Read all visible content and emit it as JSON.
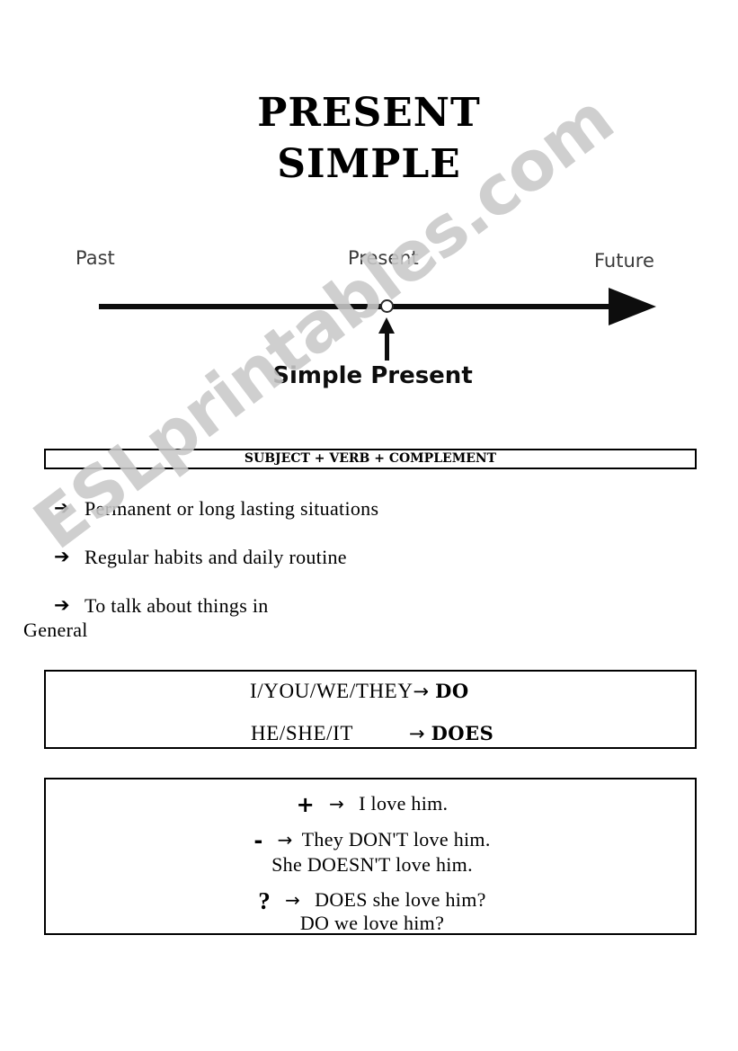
{
  "document": {
    "title_lines": [
      "PRESENT",
      "SIMPLE"
    ],
    "watermark": "ESLprintables.com"
  },
  "timeline": {
    "labels": {
      "past": "Past",
      "present": "Present",
      "future": "Future"
    },
    "caption": "Simple Present",
    "marker_icon": "timeline-now-dot",
    "pointer_icon": "up-arrow-icon",
    "axis_arrow_icon": "right-arrowhead-icon"
  },
  "formula": {
    "text": "SUBJECT + VERB + COMPLEMENT"
  },
  "usage": {
    "bullet_glyph": "➔",
    "items": [
      {
        "text": "Permanent or long lasting situations"
      },
      {
        "text": "Regular habits and daily routine"
      },
      {
        "text": "To talk about things in",
        "text_wrap": "General"
      }
    ]
  },
  "auxiliaries": {
    "arrow_glyph": "→",
    "rows": [
      {
        "subjects": "I/YOU/WE/THEY",
        "aux": "DO"
      },
      {
        "subjects": "HE/SHE/IT",
        "aux": "DOES"
      }
    ]
  },
  "examples": {
    "arrow_glyph": "→",
    "lines": [
      {
        "symbol": "+",
        "sentence": "I love him."
      },
      {
        "symbol": "-",
        "sentence": "They DON'T love him."
      },
      {
        "symbol": "",
        "sentence": "She DOESN'T love him."
      },
      {
        "symbol": "?",
        "sentence": "DOES she love him?"
      },
      {
        "symbol": "",
        "sentence": "DO we love him?"
      }
    ]
  },
  "colors": {
    "ink": "#000000",
    "timeline_label": "#3b3b3b",
    "watermark": "#c9c9c9",
    "page_background": "#ffffff"
  }
}
